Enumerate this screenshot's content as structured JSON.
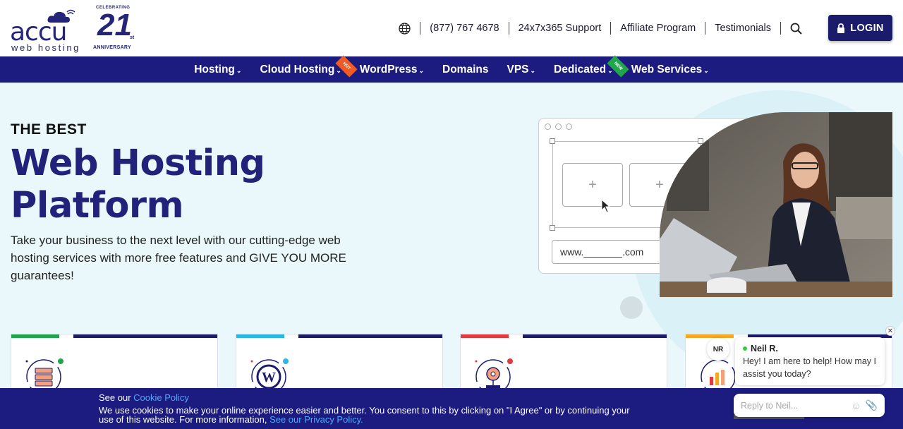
{
  "logo": {
    "word": "accu",
    "sub": "web hosting",
    "badge_top": "CELEBRATING",
    "badge_number": "21",
    "badge_suffix": "st",
    "badge_bottom": "ANNIVERSARY"
  },
  "topnav": {
    "phone": "(877) 767 4678",
    "support": "24x7x365 Support",
    "affiliate": "Affiliate Program",
    "testimonials": "Testimonials",
    "login": "LOGIN"
  },
  "mainnav": {
    "items": [
      {
        "label": "Hosting"
      },
      {
        "label": "Cloud Hosting",
        "ribbon": "HOT"
      },
      {
        "label": "WordPress"
      },
      {
        "label": "Domains"
      },
      {
        "label": "VPS"
      },
      {
        "label": "Dedicated",
        "ribbon": "NEW"
      },
      {
        "label": "Web Services"
      }
    ]
  },
  "hero": {
    "eyebrow": "THE BEST",
    "title_line1": "Web Hosting",
    "title_line2": "Platform",
    "description": "Take your business to the next level with our cutting-edge web hosting services with more free features and GIVE YOU MORE guarantees!",
    "url_mock": "www._______.com"
  },
  "cards": [
    {
      "accent": "#1fa64a",
      "icon": "server-icon"
    },
    {
      "accent": "#29b6e8",
      "icon": "wordpress-icon"
    },
    {
      "accent": "#e03a3e",
      "icon": "gear-cloud-icon"
    },
    {
      "accent": "#f5a623",
      "icon": "chart-icon"
    }
  ],
  "chat": {
    "initials": "NR",
    "agent_name": "Neil R.",
    "message": "Hey! I am here to help! How may I assist you today?",
    "reply_placeholder": "Reply to Neil..."
  },
  "cookie": {
    "see_our": "See our",
    "policy_link": "Cookie Policy",
    "body": "We use cookies to make your online experience easier and better. You consent to this by clicking on \"I Agree\" or by continuing your use of this website. For more information,",
    "privacy_link": "See our Privacy Policy."
  },
  "colors": {
    "brand_navy": "#1c1c80",
    "hero_bg": "#eaf8fb",
    "link_blue": "#4aa8ff"
  }
}
